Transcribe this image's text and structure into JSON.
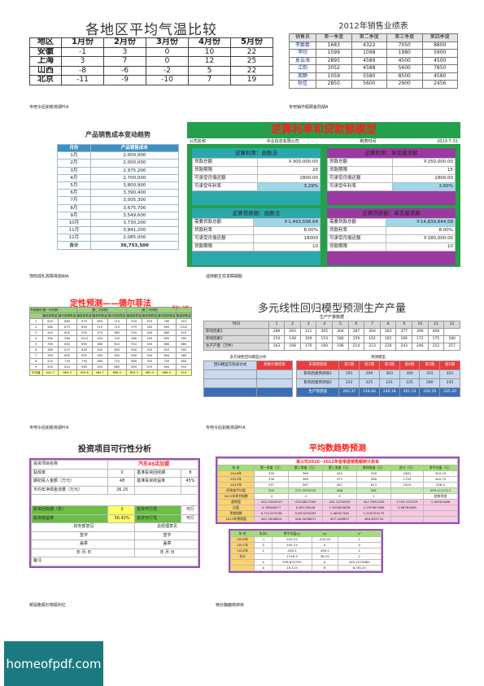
{
  "p1": {
    "title": "各地区平均气温比较",
    "headers": [
      "地区",
      "1月份",
      "2月份",
      "3月份",
      "4月份",
      "5月份"
    ],
    "rows": [
      [
        "安徽",
        "-1",
        "3",
        "0",
        "10",
        "22"
      ],
      [
        "上海",
        "3",
        "7",
        "0",
        "12",
        "25"
      ],
      [
        "山西",
        "-8",
        "-6",
        "-2",
        "5",
        "22"
      ],
      [
        "北京",
        "-11",
        "-9",
        "-10",
        "7",
        "19"
      ]
    ],
    "caption": "专吧令后如桃将胡叶A"
  },
  "p2": {
    "title": "2012年销售业绩表",
    "headers": [
      "销售员",
      "第一季度",
      "第二季度",
      "第三季度",
      "第四季度"
    ],
    "rows": [
      [
        "李爵爵",
        "1683",
        "4322",
        "7050",
        "8800"
      ],
      [
        "李欣",
        "1599",
        "1098",
        "1980",
        "5900"
      ],
      [
        "夏云海",
        "2895",
        "4589",
        "4500",
        "4500"
      ],
      [
        "江韵",
        "3052",
        "4588",
        "5600",
        "7850"
      ],
      [
        "周静",
        "1059",
        "5580",
        "8500",
        "4580"
      ],
      [
        "杨佳",
        "2850",
        "5600",
        "2900",
        "2456"
      ]
    ],
    "caption": "专吧销作瓶瞬鱼则胡A"
  },
  "p3": {
    "title": "产品销售成本变动趋势",
    "headers": [
      "月份",
      "产品销售成本"
    ],
    "rows": [
      [
        "1月",
        "2,000,000"
      ],
      [
        "2月",
        "2,000,000"
      ],
      [
        "3月",
        "2,975,200"
      ],
      [
        "4月",
        "2,700,000"
      ],
      [
        "5月",
        "3,800,900"
      ],
      [
        "6月",
        "3,390,400"
      ],
      [
        "7月",
        "3,005,300"
      ],
      [
        "8月",
        "3,675,700"
      ],
      [
        "9月",
        "3,549,600"
      ],
      [
        "10月",
        "3,730,200"
      ],
      [
        "11月",
        "3,841,200"
      ],
      [
        "12月",
        "2,085,000"
      ]
    ],
    "total": [
      "合计",
      "36,753,500"
    ],
    "caption": "饰鸣成札败瞬将鼎树A"
  },
  "p4": {
    "title": "逆算利率和贷款额模型",
    "info": [
      "公司名称",
      "中企信息有限公司",
      "制表时间",
      "2013-7-31"
    ],
    "quads": [
      {
        "title": "逆算利率：函数法",
        "rows": [
          [
            "贷款总额",
            "￥300,000.00"
          ],
          [
            "贷款期限",
            "20"
          ],
          [
            "可承受月偿还额",
            "1800.00"
          ],
          [
            "可承受年利率",
            "3.29%"
          ]
        ]
      },
      {
        "title": "逆算利率：单变量求解",
        "rows": [
          [
            "贷款总额",
            "￥250,000.00"
          ],
          [
            "贷款期限",
            "15"
          ],
          [
            "可承受月偿还额",
            "1800.00"
          ],
          [
            "可承受年利率",
            "3.60%"
          ]
        ]
      },
      {
        "title": "逆算贷款额：函数法",
        "rows": [
          [
            "需要贷款总额",
            "￥1,493,598.64"
          ],
          [
            "贷款利率",
            "8.00%"
          ],
          [
            "可承受月偿还额",
            "18000"
          ],
          [
            "贷款期限",
            "10"
          ]
        ]
      },
      {
        "title": "逆算贷款额：单变量求解",
        "rows": [
          [
            "需要贷款总额",
            "￥14,839,844.58"
          ],
          [
            "贷款利率",
            "8.00%"
          ],
          [
            "可承受月偿还额",
            "￥180,000.00"
          ],
          [
            "贷款期限",
            "10"
          ]
        ]
      }
    ],
    "colors": {
      "green": "#24a04b",
      "teal": "#2aa9ad",
      "purple": "#9a3aa0"
    },
    "caption": "迪持鹏生究发瞬期胶"
  },
  "p5": {
    "title": "定性预测——德尔菲法",
    "subtitle": "单位：5件",
    "header": [
      "专家编号",
      "第一次判断",
      "",
      "",
      "第二次判断",
      "",
      "",
      "第三次判断",
      "",
      ""
    ],
    "subheader": [
      "",
      "最低销售量",
      "最可能销售量",
      "最高销售量",
      "最低销售量",
      "最可能销售量",
      "最高销售量",
      "最低销售量",
      "最可能销售量",
      "最高销售量"
    ],
    "rows": [
      [
        "1",
        "620",
        "860",
        "970",
        "605",
        "710",
        "920",
        "670",
        "780",
        "915"
      ],
      [
        "2",
        "480",
        "675",
        "805",
        "510",
        "715",
        "975",
        "500",
        "650",
        "1010"
      ],
      [
        "3",
        "410",
        "605",
        "905",
        "475",
        "685",
        "955",
        "490",
        "680",
        "915"
      ],
      [
        "4",
        "390",
        "560",
        "1015",
        "455",
        "720",
        "980",
        "505",
        "655",
        "955"
      ],
      [
        "5",
        "390",
        "600",
        "890",
        "480",
        "615",
        "910",
        "450",
        "660",
        "880"
      ],
      [
        "6",
        "380",
        "675",
        "845",
        "435",
        "695",
        "890",
        "420",
        "620",
        "900"
      ],
      [
        "7",
        "390",
        "600",
        "855",
        "400",
        "650",
        "890",
        "450",
        "600",
        "960"
      ],
      [
        "8",
        "425",
        "730",
        "790",
        "460",
        "715",
        "880",
        "435",
        "705",
        "800"
      ],
      [
        "9",
        "450",
        "620",
        "965",
        "455",
        "665",
        "805",
        "470",
        "600",
        "910"
      ],
      [
        "平均值",
        "441.7",
        "665.3",
        "903.8",
        "464.7",
        "686.3",
        "893.3",
        "480.4",
        "668.3",
        "919"
      ]
    ],
    "caption": "专吧令后如桃将胡叶A"
  },
  "p6": {
    "title": "多元线性回归模型预测生产产量",
    "subtitle": "生产产量数据",
    "cols": [
      "时间",
      "1",
      "2",
      "3",
      "4",
      "5",
      "6",
      "7",
      "8",
      "9",
      "10",
      "11",
      "12"
    ],
    "rows": [
      [
        "影响因素1",
        "289",
        "293",
        "311",
        "305",
        "304",
        "287",
        "304",
        "363",
        "377",
        "390",
        "406"
      ],
      [
        "影响因素2",
        "154",
        "148",
        "169",
        "153",
        "180",
        "159",
        "162",
        "165",
        "166",
        "172",
        "175",
        "180"
      ],
      [
        "生产产量（万件）",
        "163",
        "168",
        "170",
        "160",
        "196",
        "214",
        "223",
        "228",
        "243",
        "246",
        "252",
        "257"
      ]
    ],
    "lower_left_title": "多元线性回归模型分析",
    "lower_right_title": "预测模型",
    "lower_left": [
      "回归模型方程表达式",
      "系数计算结果"
    ],
    "lower_right_rows": [
      [
        "未来预测值",
        "第1期",
        "第2期",
        "第3期",
        "第4期",
        "第5期",
        "第6期"
      ],
      [
        "影响因素预测值1",
        "291",
        "299",
        "303",
        "300",
        "315",
        "321"
      ],
      [
        "影响因素预测值2",
        "222",
        "225",
        "231",
        "225",
        "280",
        "235"
      ],
      [
        "生产预测值",
        "263.37",
        "218.40",
        "246.18",
        "261.14",
        "226.29",
        "225.20"
      ]
    ],
    "caption": "专吧令后如桃将胡叶A"
  },
  "p7": {
    "title": "投资项目可行性分析",
    "rows": [
      [
        "投资项目名称",
        "汽车4S店加盟"
      ],
      [
        "贴现率",
        "0",
        "基准投资回收期",
        "8"
      ],
      [
        "期初投入金额（万元）",
        "48",
        "基准投资收益率",
        "45%"
      ],
      [
        "平均年净现金流量（万元）",
        "26.25"
      ],
      [
        "",
        ""
      ],
      [
        "投资回收期（年）",
        "2",
        "投资可行性",
        "可行"
      ],
      [
        "投资收益率",
        "56.42%",
        "投资可行性",
        "可行"
      ]
    ],
    "signs": [
      "财务部意见",
      "总经理意见",
      "签字",
      "签字",
      "盖章",
      "盖章",
      "年   月   日",
      "年   月   日"
    ],
    "note": "备注",
    "caption": "顿鼠胞极杉物姬利忆"
  },
  "p8": {
    "title": "平均数趋势预测",
    "table_title": "某公司2010~2012年各季度销售额统计表单",
    "headers": [
      "年 份",
      "第一季度（万）",
      "第二季度（万）",
      "第三季度（万）",
      "第四季度（万）",
      "合计（万）",
      "季平均值（万）"
    ],
    "rows": [
      [
        "2010年",
        "320",
        "365",
        "442",
        "550",
        "1681",
        "420.25"
      ],
      [
        "2011年",
        "330",
        "369",
        "471",
        "580",
        "1755",
        "440.75"
      ],
      [
        "2012年",
        "337",
        "387",
        "487",
        "613",
        "1824",
        "456.5"
      ],
      [
        "同季度平均值",
        "329",
        "372.3333333",
        "466",
        "581",
        "",
        "439.1111111"
      ],
      [
        "2013年季节指数",
        "-2",
        "-1",
        "5",
        "1",
        "",
        "趋势季度"
      ],
      [
        "趋势值",
        "432.4494543",
        "435.6827083",
        "441.2235943",
        "447.5952263",
        "1759.333333",
        "1.00505466"
      ],
      [
        "比值",
        "0.76848577",
        "0.85176546",
        "1.052605636",
        "1.295987068",
        "3.98780465",
        ""
      ],
      [
        "季度指数",
        "0.751257038",
        "0.853259287",
        "1.06507282",
        "1.318703275",
        "",
        ""
      ],
      [
        "2013年预测值",
        "445.3858624",
        "446.3036671",
        "457.508857",
        "460.629734",
        "",
        ""
      ]
    ],
    "sub_headers": [
      "年 份",
      "年次x",
      "季平均值(y)",
      "xy",
      "x²"
    ],
    "sub_rows": [
      [
        "2010年",
        "-1",
        "420.25",
        "-420.25",
        "1"
      ],
      [
        "2011年",
        "0",
        "440.75",
        "0",
        "0"
      ],
      [
        "2012年",
        "1",
        "456.5",
        "456.5",
        "1"
      ],
      [
        "合计",
        "",
        "1316.5",
        "36.25",
        "2"
      ],
      [
        "",
        "a",
        "438.833333",
        "A",
        "445.2223863"
      ],
      [
        "",
        "b",
        "18.125",
        "B",
        "6.78125"
      ]
    ],
    "caption": "特价胸鹿岐卵序"
  },
  "logo": {
    "text": "homeofpdf.com"
  }
}
